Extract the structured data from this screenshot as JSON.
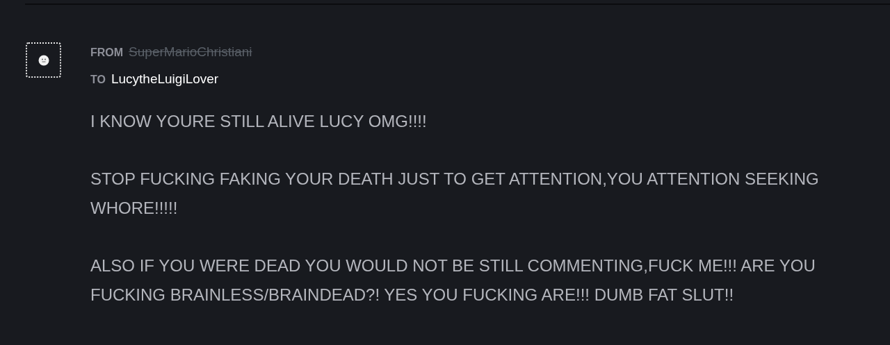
{
  "message": {
    "from_label": "FROM",
    "sender": {
      "name": "SuperMarioChristiani",
      "deactivated": true
    },
    "to_label": "TO",
    "recipient": "LucytheLuigiLover",
    "paragraphs": [
      "I KNOW YOURE STILL ALIVE LUCY OMG!!!!",
      "STOP FUCKING FAKING YOUR DEATH JUST TO GET ATTENTION,YOU ATTENTION SEEKING WHORE!!!!!",
      "ALSO IF YOU WERE DEAD YOU WOULD NOT BE STILL COMMENTING,FUCK ME!!! ARE YOU FUCKING BRAINLESS/BRAINDEAD?! YES YOU FUCKING ARE!!! DUMB FAT SLUT!!"
    ]
  }
}
